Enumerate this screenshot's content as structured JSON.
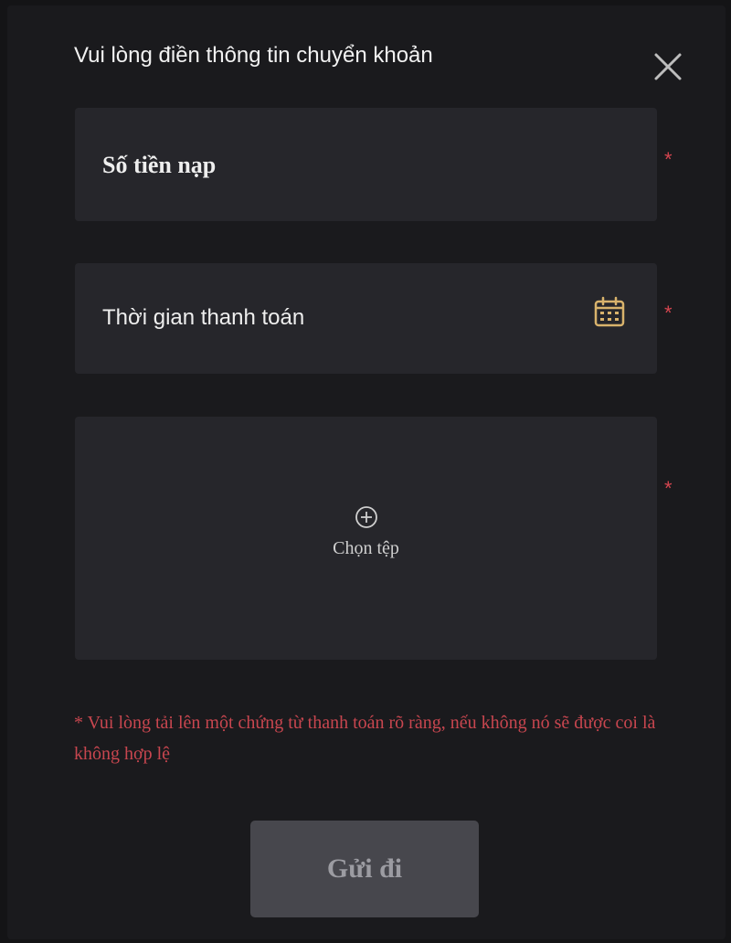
{
  "dialog": {
    "title": "Vui lòng điền thông tin chuyển khoản",
    "close_icon": "close-icon"
  },
  "fields": {
    "amount": {
      "placeholder": "Số tiền nạp",
      "required_mark": "*"
    },
    "payment_time": {
      "placeholder": "Thời gian thanh toán",
      "icon": "calendar-icon",
      "required_mark": "*"
    },
    "upload": {
      "label": "Chọn tệp",
      "icon": "plus-circle-icon",
      "required_mark": "*"
    }
  },
  "warning_text": "* Vui lòng tải lên một chứng từ thanh toán rõ ràng, nếu không nó sẽ được coi là không hợp lệ",
  "submit_label": "Gửi đi",
  "colors": {
    "background": "#1a1a1d",
    "field_background": "#26262b",
    "required": "#d4454f",
    "accent_icon": "#d9b36c",
    "submit_background": "#47474d"
  }
}
